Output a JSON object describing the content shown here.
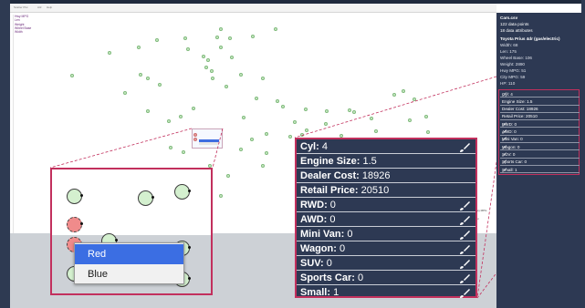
{
  "titlebar": {
    "tabs": [
      "Scatter Plot",
      "Attr",
      "Help"
    ]
  },
  "legend": {
    "items": [
      "Hwy MPG",
      "Len",
      "Weight",
      "Wheel Base",
      "Width"
    ]
  },
  "mini_menu": {
    "items": [
      "Red",
      "Blue"
    ]
  },
  "zoom_menu": {
    "items": [
      {
        "label": "Red",
        "selected": true
      },
      {
        "label": "Blue",
        "selected": false
      }
    ]
  },
  "attributes": {
    "rows": [
      {
        "name": "Cyl:",
        "value": "4",
        "brush": true
      },
      {
        "name": "Engine Size:",
        "value": "1.5",
        "brush": false
      },
      {
        "name": "Dealer Cost:",
        "value": "18926",
        "brush": false
      },
      {
        "name": "Retail Price:",
        "value": "20510",
        "brush": false
      },
      {
        "name": "RWD:",
        "value": "0",
        "brush": true
      },
      {
        "name": "AWD:",
        "value": "0",
        "brush": true
      },
      {
        "name": "Mini Van:",
        "value": "0",
        "brush": true
      },
      {
        "name": "Wagon:",
        "value": "0",
        "brush": true
      },
      {
        "name": "SUV:",
        "value": "0",
        "brush": true
      },
      {
        "name": "Sports Car:",
        "value": "0",
        "brush": true
      },
      {
        "name": "Small:",
        "value": "1",
        "brush": true
      }
    ]
  },
  "sidebar": {
    "file": "Cars.csv",
    "points": "122 data points",
    "attrs": "18 data attributes",
    "car_name": "Toyota Prius 4dr (gas/electric)",
    "details": [
      "Width: 68",
      "Len: 175",
      "Wheel Base: 106",
      "Weight: 2890",
      "Hwy MPG: 51",
      "City MPG: 59",
      "HP: 110"
    ],
    "rows": [
      {
        "label": "Cyl: 4",
        "brush": true
      },
      {
        "label": "Engine Size: 1.5",
        "brush": false
      },
      {
        "label": "Dealer Cost: 18926",
        "brush": false
      },
      {
        "label": "Retail Price: 20510",
        "brush": false
      },
      {
        "label": "RWD: 0",
        "brush": true
      },
      {
        "label": "AWD: 0",
        "brush": true
      },
      {
        "label": "Mini Van: 0",
        "brush": true
      },
      {
        "label": "Wagon: 0",
        "brush": true
      },
      {
        "label": "SUV: 0",
        "brush": true
      },
      {
        "label": "Sports Car: 0",
        "brush": true
      },
      {
        "label": "Small: 1",
        "brush": true
      }
    ]
  },
  "plot": {
    "axis_labels": [
      "Hwy MPG",
      "Len",
      "Weight",
      "Wheel Base",
      "Width"
    ],
    "dot_fill": "#cfeccb",
    "dot_stroke": "#7fb97b",
    "highlight_fill": "#f08b8b"
  },
  "colors": {
    "panel_bg": "#2d3953",
    "accent": "#c2305d",
    "menu_selected": "#3b6ee3"
  }
}
